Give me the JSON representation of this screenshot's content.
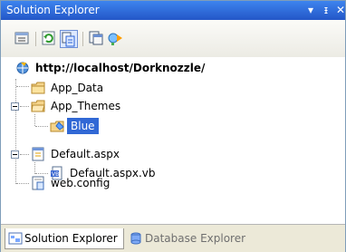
{
  "window": {
    "title": "Solution Explorer",
    "buttons": {
      "dropdown": "▾",
      "pin": "ᵻ",
      "close": "✕"
    }
  },
  "toolbar": {
    "icons": [
      "properties-icon",
      "refresh-icon",
      "nest-related-files-icon",
      "view-code-icon",
      "copy-website-icon"
    ]
  },
  "tree": {
    "root": "http://localhost/Dorknozzle/",
    "items": [
      {
        "label": "App_Data"
      },
      {
        "label": "App_Themes"
      },
      {
        "label": "Blue"
      },
      {
        "label": "Default.aspx"
      },
      {
        "label": "Default.aspx.vb"
      },
      {
        "label": "web.config"
      }
    ]
  },
  "tabs": [
    {
      "label": "Solution Explorer",
      "active": true
    },
    {
      "label": "Database Explorer",
      "active": false
    }
  ],
  "colors": {
    "title_bar": "#2b62d5",
    "selection": "#3168d5",
    "accent": "#4a7ed8"
  }
}
